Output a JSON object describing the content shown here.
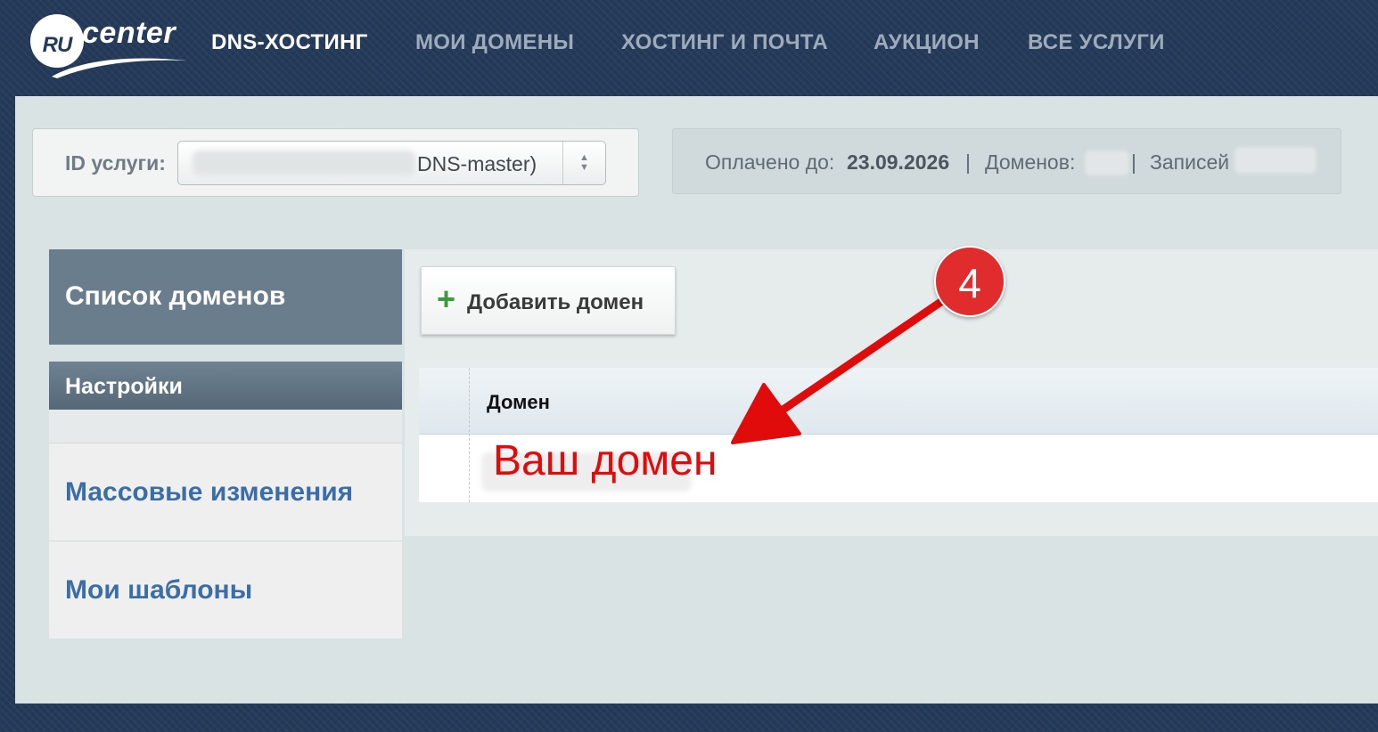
{
  "logo": {
    "ru": "RU",
    "center": "center"
  },
  "nav": {
    "items": [
      {
        "label": "DNS-ХОСТИНГ",
        "active": true
      },
      {
        "label": "МОИ ДОМЕНЫ",
        "active": false
      },
      {
        "label": "ХОСТИНГ И ПОЧТА",
        "active": false
      },
      {
        "label": "АУКЦИОН",
        "active": false
      },
      {
        "label": "ВСЕ УСЛУГИ",
        "active": false
      }
    ]
  },
  "service": {
    "label": "ID услуги:",
    "selected_value": "DNS-master)"
  },
  "info": {
    "paid_label": "Оплачено до:",
    "paid_date": "23.09.2026",
    "separator": "|",
    "domains_label": "Доменов:",
    "records_label": "Записей"
  },
  "sidebar": {
    "domains_list": "Список доменов",
    "settings": "Настройки",
    "mass_changes": "Массовые изменения",
    "my_templates": "Мои шаблоны"
  },
  "content": {
    "add_domain_button": "Добавить домен",
    "add_icon": "+",
    "table": {
      "header_domain": "Домен",
      "rows": [
        {
          "domain": "Ваш домен"
        }
      ]
    }
  },
  "annotation": {
    "step_number": "4",
    "color": "#e02c2c"
  },
  "colors": {
    "header_bg": "#243a59",
    "nav_active": "#ffffff",
    "nav_inactive": "#9eabbb",
    "sidebar_active": "#6a7d8c",
    "link_blue": "#3b6ea6",
    "annotation_red": "#e00b0b"
  }
}
